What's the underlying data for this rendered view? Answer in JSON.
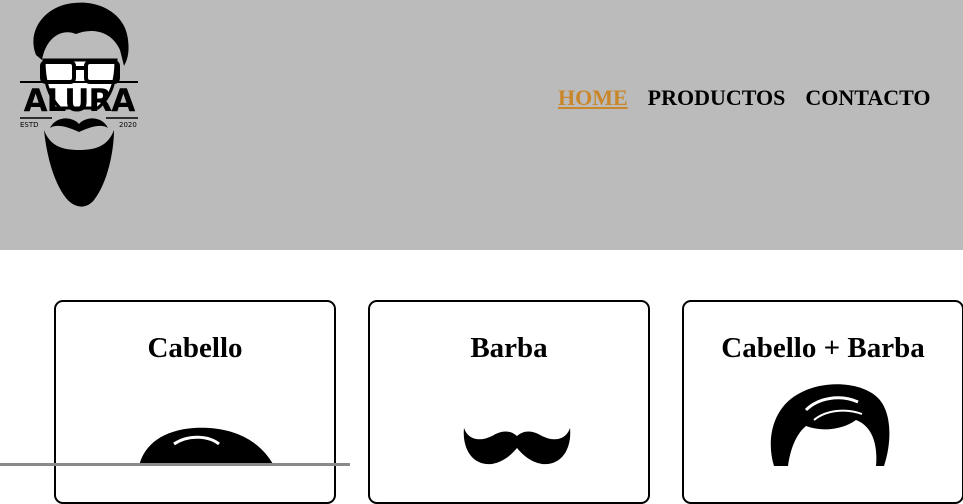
{
  "header": {
    "logo": {
      "brand": "ALURA",
      "est_label": "ESTD",
      "year": "2020",
      "icon": "bearded-man-glasses-logo"
    },
    "nav": [
      {
        "label": "HOME",
        "active": true
      },
      {
        "label": "PRODUCTOS",
        "active": false
      },
      {
        "label": "CONTACTO",
        "active": false
      }
    ],
    "colors": {
      "background": "#bbbbbb",
      "active_link": "#c9872a"
    }
  },
  "products": [
    {
      "title": "Cabello",
      "icon": "hair-icon"
    },
    {
      "title": "Barba",
      "icon": "mustache-icon"
    },
    {
      "title": "Cabello + Barba",
      "icon": "hair-icon"
    }
  ]
}
